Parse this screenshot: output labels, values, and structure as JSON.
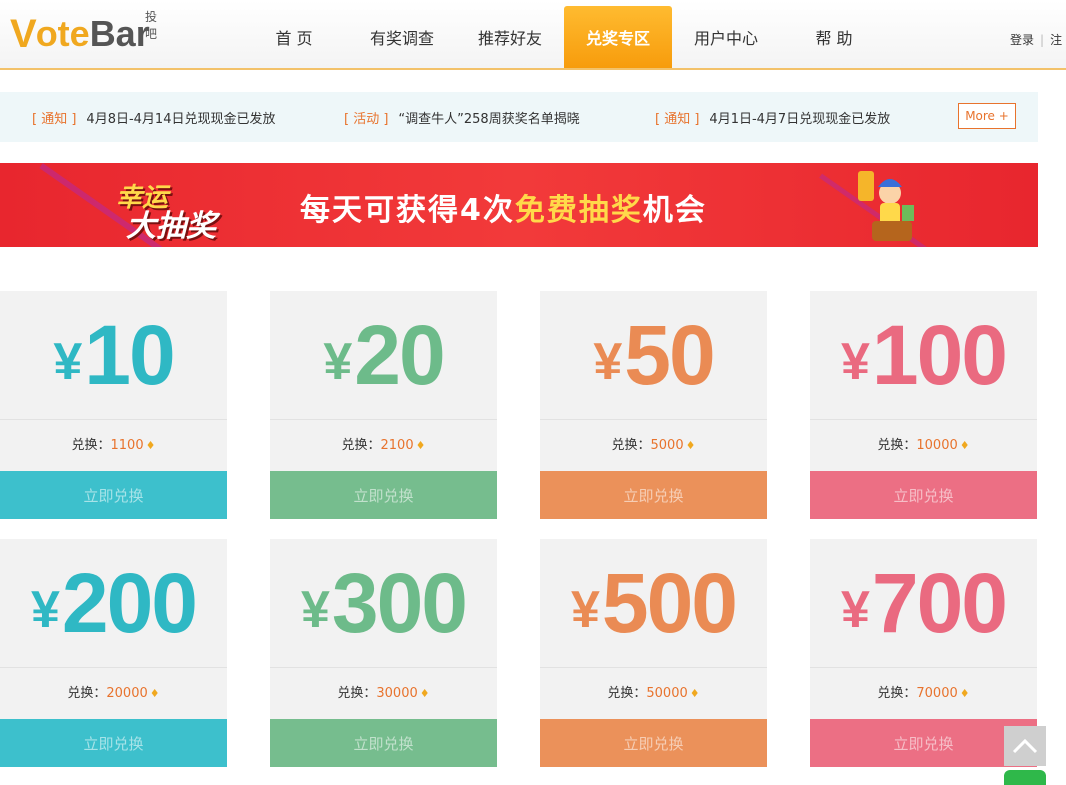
{
  "header": {
    "logo_v": "V",
    "logo_ote": "ote",
    "logo_bar": "Bar",
    "logo_sub": "投吧",
    "nav": [
      "首 页",
      "有奖调查",
      "推荐好友",
      "兑奖专区",
      "用户中心",
      "帮 助"
    ],
    "active_nav": "兑奖专区",
    "login": "登录",
    "register": "注"
  },
  "notices": [
    {
      "tag": "[ 通知 ]",
      "text": "4月8日-4月14日兑现现金已发放"
    },
    {
      "tag": "[ 活动 ]",
      "text": "“调查牛人”258周获奖名单揭晓"
    },
    {
      "tag": "[ 通知 ]",
      "text": "4月1日-4月7日兑现现金已发放"
    }
  ],
  "more_label": "More +",
  "banner": {
    "lucky_line1": "幸运",
    "lucky_line2": "大抽奖",
    "text_before": "每天可获得4次",
    "text_highlight": "免费抽奖",
    "text_after": "机会"
  },
  "cards": [
    {
      "yen": "¥",
      "amount": "10",
      "label": "兑换：",
      "points": "1100",
      "button": "立即兑换"
    },
    {
      "yen": "¥",
      "amount": "20",
      "label": "兑换：",
      "points": "2100",
      "button": "立即兑换"
    },
    {
      "yen": "¥",
      "amount": "50",
      "label": "兑换：",
      "points": "5000",
      "button": "立即兑换"
    },
    {
      "yen": "¥",
      "amount": "100",
      "label": "兑换：",
      "points": "10000",
      "button": "立即兑换"
    },
    {
      "yen": "¥",
      "amount": "200",
      "label": "兑换：",
      "points": "20000",
      "button": "立即兑换"
    },
    {
      "yen": "¥",
      "amount": "300",
      "label": "兑换：",
      "points": "30000",
      "button": "立即兑换"
    },
    {
      "yen": "¥",
      "amount": "500",
      "label": "兑换：",
      "points": "50000",
      "button": "立即兑换"
    },
    {
      "yen": "¥",
      "amount": "700",
      "label": "兑换：",
      "points": "70000",
      "button": "立即兑换"
    }
  ],
  "icons": {
    "gem": "diamond-icon",
    "scroll_top": "chevron-up-icon",
    "chat": "wechat-icon"
  },
  "colors": {
    "brand": "#f0a81f",
    "teal": "#3dc0cc",
    "green": "#76bd8e",
    "orange": "#eb915a",
    "pink": "#ec6f84",
    "banner_red": "#e8262e"
  }
}
